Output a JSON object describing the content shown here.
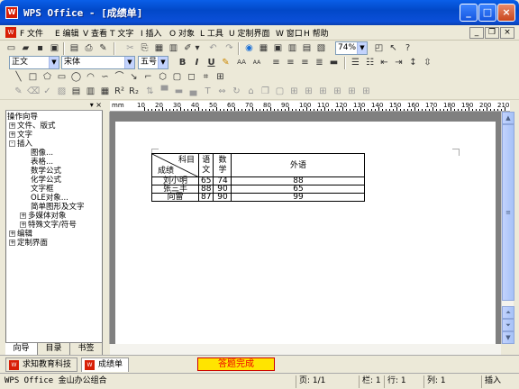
{
  "window": {
    "title": "WPS Office - [成绩单]",
    "app_icon": "W",
    "controls": [
      "_",
      "□",
      "×"
    ]
  },
  "menubar": {
    "items": [
      "F 文件",
      "E 编辑",
      "V 查看",
      "T 文字",
      "I 插入",
      "O 对象",
      "L 工具",
      "U 定制界面",
      "W 窗口",
      "H 帮助"
    ],
    "mdi_controls": [
      "_",
      "❐",
      "×"
    ]
  },
  "toolbar_standard": {
    "zoom": "74%"
  },
  "toolbar_format": {
    "style": "正文",
    "font": "宋体",
    "size": "五号",
    "bold": "B",
    "italic": "I",
    "underline": "U",
    "grow_font": "AA",
    "shrink_font": "AA"
  },
  "nav_panel": {
    "title": "操作向导",
    "tree": [
      {
        "expander": "+",
        "label": "文件、版式",
        "level": 0
      },
      {
        "expander": "+",
        "label": "文字",
        "level": 0
      },
      {
        "expander": "-",
        "label": "插入",
        "level": 0
      },
      {
        "expander": "",
        "label": "图像...",
        "level": 2
      },
      {
        "expander": "",
        "label": "表格...",
        "level": 2
      },
      {
        "expander": "",
        "label": "数学公式",
        "level": 2
      },
      {
        "expander": "",
        "label": "化学公式",
        "level": 2
      },
      {
        "expander": "",
        "label": "文字框",
        "level": 2
      },
      {
        "expander": "",
        "label": "OLE对象...",
        "level": 2
      },
      {
        "expander": "",
        "label": "简单图形及文字",
        "level": 2
      },
      {
        "expander": "+",
        "label": "多媒体对象",
        "level": 1
      },
      {
        "expander": "+",
        "label": "特殊文字/符号",
        "level": 1
      },
      {
        "expander": "+",
        "label": "编辑",
        "level": 0
      },
      {
        "expander": "+",
        "label": "定制界面",
        "level": 0
      }
    ],
    "tabs": [
      "向导",
      "目录",
      "书签"
    ]
  },
  "ruler": {
    "unit": "mm",
    "labels": [
      "10",
      "20",
      "30",
      "40",
      "50",
      "60",
      "70",
      "80",
      "90",
      "100",
      "110",
      "120",
      "130",
      "140",
      "150",
      "160",
      "170",
      "180",
      "190",
      "200",
      "210"
    ]
  },
  "grade_table": {
    "header_diag_top": "科目",
    "header_diag_bottom": "成绩",
    "col_chinese": "语文",
    "col_math": "数学",
    "col_english": "外语",
    "rows": [
      {
        "name": "刘小明",
        "chinese": "65",
        "math": "74",
        "english": "88"
      },
      {
        "name": "张三丰",
        "chinese": "88",
        "math": "90",
        "english": "65"
      },
      {
        "name": "向雷",
        "chinese": "87",
        "math": "90",
        "english": "99"
      }
    ]
  },
  "doc_tabs": [
    {
      "label": "求知教育科技",
      "active": false
    },
    {
      "label": "成绩单",
      "active": true
    }
  ],
  "done_box": "答题完成",
  "statusbar": {
    "app": "WPS Office 金山办公组合",
    "page": "页: 1/1",
    "column": "栏: 1",
    "line": "行: 1",
    "col": "列: 1",
    "mode": "插入"
  }
}
